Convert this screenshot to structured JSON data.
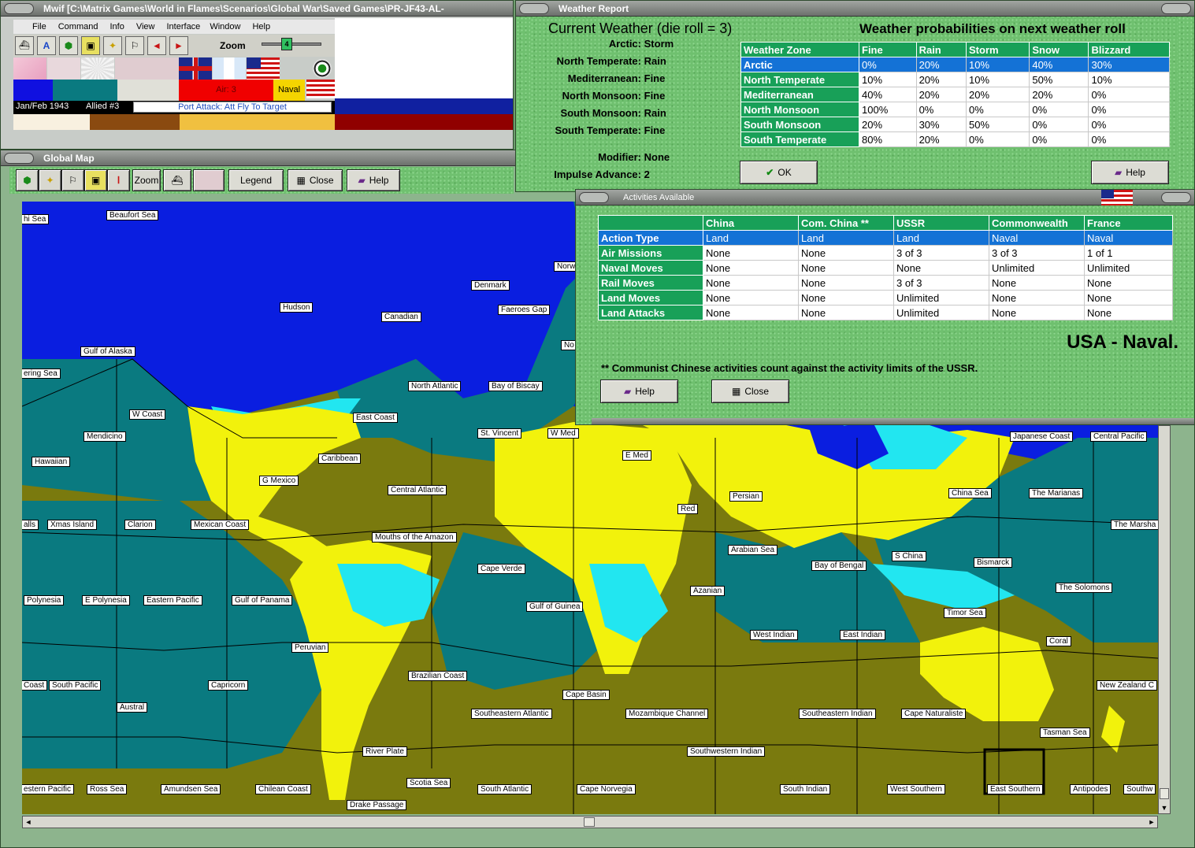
{
  "main_window": {
    "title": "Mwif [C:\\Matrix Games\\World in Flames\\Scenarios\\Global War\\Saved Games\\PR-JF43-AL-",
    "menu": [
      "File",
      "Command",
      "Info",
      "View",
      "Interface",
      "Window",
      "Help"
    ],
    "zoom_label": "Zoom",
    "zoom_value": "4",
    "status_date": "Jan/Feb 1943",
    "status_side": "Allied #3",
    "status_phase": "Port Attack: Att Fly To Target",
    "air_label": "Air: 3",
    "naval_label": "Naval"
  },
  "global_map": {
    "title": "Global Map",
    "zoom_button": "Zoom",
    "legend_button": "Legend",
    "close_button": "Close",
    "help_button": "Help",
    "colors": {
      "deep": "#0a1ee0",
      "ocean": "#0a7a80",
      "land": "#7a7a0e",
      "desert": "#f2f20c",
      "ice": "#22e6f0"
    },
    "sea_labels": [
      "hi Sea",
      "Beaufort Sea",
      "Norw",
      "Denmark",
      "Hudson",
      "Canadian",
      "Faeroes Gap",
      "Gulf of Alaska",
      "No",
      "ering Sea",
      "North Atlantic",
      "Bay of Biscay",
      "W Coast",
      "East Coast",
      "Mendicino",
      "St. Vincent",
      "W Med",
      "Hawaiian",
      "E Med",
      "Caribbean",
      "G Mexico",
      "Central Atlantic",
      "Persian",
      "alls",
      "Xmas Island",
      "Clarion",
      "Mexican Coast",
      "Red",
      "Mouths of the Amazon",
      "Arabian Sea",
      "Cape Verde",
      "Polynesia",
      "E Polynesia",
      "Eastern Pacific",
      "Gulf of Panama",
      "Azanian",
      "Gulf of Guinea",
      "West Indian",
      "East Indian",
      "Peruvian",
      "Brazilian Coast",
      "Coast",
      "South Pacific",
      "Capricorn",
      "Cape Basin",
      "Austral",
      "Southeastern Atlantic",
      "Mozambique Channel",
      "Southeastern Indian",
      "Cape Naturaliste",
      "River Plate",
      "Southwestern Indian",
      "Scotia Sea",
      "estern Pacific",
      "Ross Sea",
      "Amundsen Sea",
      "Chilean Coast",
      "South Atlantic",
      "Cape Norvegia",
      "South Indian",
      "West Southern",
      "East Southern",
      "Antipodes",
      "Southw",
      "Drake Passage",
      "Japanese Coast",
      "Central Pacific",
      "China Sea",
      "The Marianas",
      "The Marsha",
      "Bay of Bengal",
      "S China",
      "Bismarck",
      "The Solomons",
      "Timor Sea",
      "Coral",
      "New Zealand C",
      "Tasman Sea"
    ]
  },
  "weather_report": {
    "title": "Weather Report",
    "current_heading": "Current Weather (die roll = 3)",
    "prob_heading": "Weather probabilities on next weather roll",
    "current": [
      {
        "zone": "Arctic:",
        "value": "Storm"
      },
      {
        "zone": "North Temperate:",
        "value": "Rain"
      },
      {
        "zone": "Mediterranean:",
        "value": "Fine"
      },
      {
        "zone": "North Monsoon:",
        "value": "Fine"
      },
      {
        "zone": "South Monsoon:",
        "value": "Rain"
      },
      {
        "zone": "South Temperate:",
        "value": "Fine"
      }
    ],
    "modifier_label": "Modifier:",
    "modifier_value": "None",
    "impulse_label": "Impulse Advance:",
    "impulse_value": "2",
    "columns": [
      "Weather Zone",
      "Fine",
      "Rain",
      "Storm",
      "Snow",
      "Blizzard"
    ],
    "rows": [
      [
        "Arctic",
        "0%",
        "20%",
        "10%",
        "40%",
        "30%"
      ],
      [
        "North Temperate",
        "10%",
        "20%",
        "10%",
        "50%",
        "10%"
      ],
      [
        "Mediterranean",
        "40%",
        "20%",
        "20%",
        "20%",
        "0%"
      ],
      [
        "North Monsoon",
        "100%",
        "0%",
        "0%",
        "0%",
        "0%"
      ],
      [
        "South Monsoon",
        "20%",
        "30%",
        "50%",
        "0%",
        "0%"
      ],
      [
        "South Temperate",
        "80%",
        "20%",
        "0%",
        "0%",
        "0%"
      ]
    ],
    "ok_button": "OK",
    "help_button": "Help"
  },
  "activities": {
    "title": "Activities Available",
    "columns": [
      "",
      "China",
      "Com. China **",
      "USSR",
      "Commonwealth",
      "France"
    ],
    "rows": [
      [
        "Action Type",
        "Land",
        "Land",
        "Land",
        "Naval",
        "Naval"
      ],
      [
        "Air Missions",
        "None",
        "None",
        "3 of 3",
        "3 of 3",
        "1 of 1"
      ],
      [
        "Naval Moves",
        "None",
        "None",
        "None",
        "Unlimited",
        "Unlimited"
      ],
      [
        "Rail Moves",
        "None",
        "None",
        "3 of 3",
        "None",
        "None"
      ],
      [
        "Land Moves",
        "None",
        "None",
        "Unlimited",
        "None",
        "None"
      ],
      [
        "Land Attacks",
        "None",
        "None",
        "Unlimited",
        "None",
        "None"
      ]
    ],
    "usa_status": "USA - Naval.",
    "footnote": "** Communist Chinese activities count against the activity limits of the USSR.",
    "help_button": "Help",
    "close_button": "Close"
  }
}
